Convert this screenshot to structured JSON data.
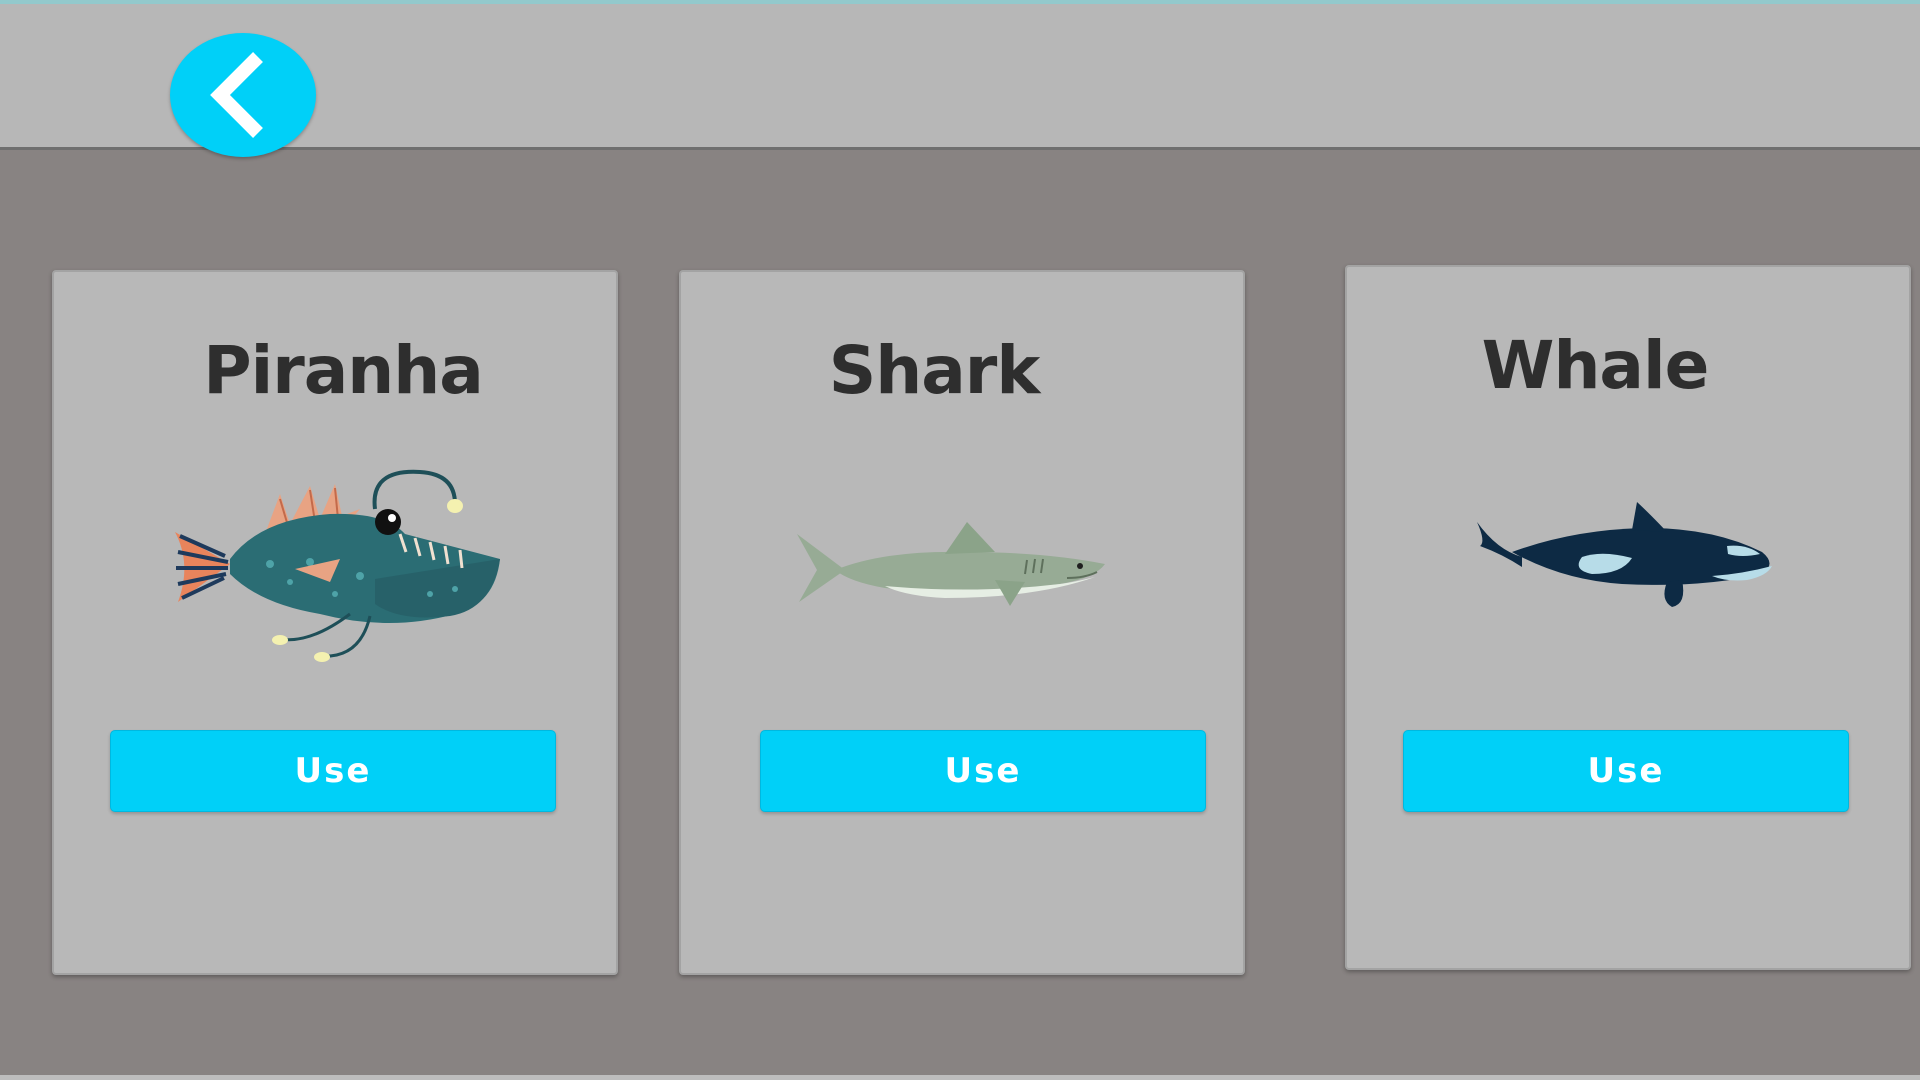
{
  "header": {
    "back_icon": "chevron-left-icon"
  },
  "cards": [
    {
      "title": "Piranha",
      "button_label": "Use",
      "icon": "anglerfish-icon"
    },
    {
      "title": "Shark",
      "button_label": "Use",
      "icon": "shark-icon"
    },
    {
      "title": "Whale",
      "button_label": "Use",
      "icon": "orca-icon"
    }
  ],
  "colors": {
    "accent": "#00d0f8",
    "background": "#888382",
    "panel": "#b8b8b8",
    "title_text": "#2e2e2e"
  }
}
